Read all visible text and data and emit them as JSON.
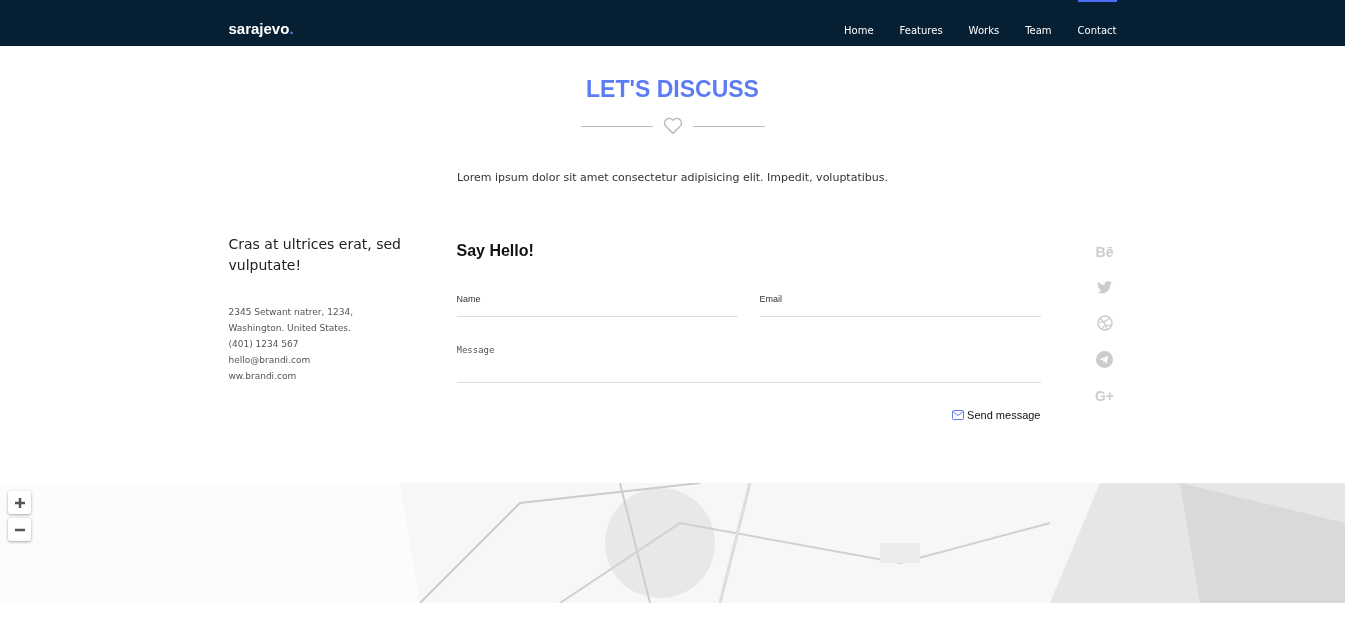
{
  "navbar": {
    "logo": "sarajevo",
    "logo_dot": ".",
    "links": [
      {
        "label": "Home",
        "selected": false
      },
      {
        "label": "Features",
        "selected": false
      },
      {
        "label": "Works",
        "selected": false
      },
      {
        "label": "Team",
        "selected": false
      },
      {
        "label": "Contact",
        "selected": true
      }
    ]
  },
  "section": {
    "title": "LET'S DISCUSS",
    "intro": "Lorem ipsum dolor sit amet consectetur adipisicing elit. Impedit, voluptatibus."
  },
  "info": {
    "heading": "Cras at ultrices erat, sed vulputate!",
    "lines": [
      "2345 Setwant natrer, 1234,",
      "Washington. United States.",
      "(401) 1234 567",
      "hello@brandi.com",
      "ww.brandi.com"
    ]
  },
  "form": {
    "title": "Say Hello!",
    "fields": [
      {
        "placeholder": "Name"
      },
      {
        "placeholder": "Email"
      }
    ],
    "message": {
      "placeholder": "Message"
    },
    "submit": "Send message"
  },
  "social": [
    {
      "kind": "behance",
      "glyph": "Bē"
    },
    {
      "kind": "twitter"
    },
    {
      "kind": "dribbble"
    },
    {
      "kind": "telegram"
    },
    {
      "kind": "gplus",
      "glyph": "G+"
    }
  ]
}
